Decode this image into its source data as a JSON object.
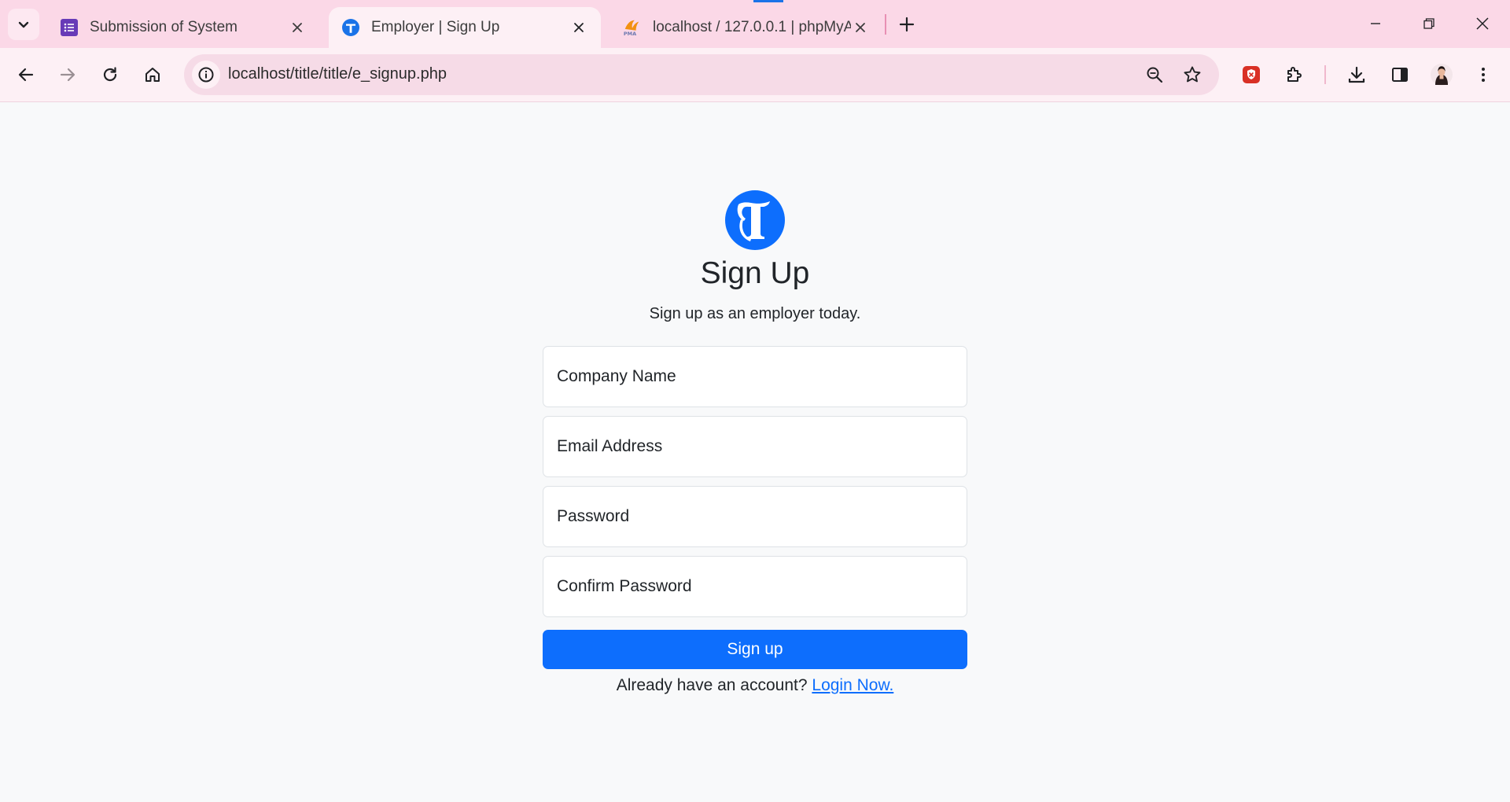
{
  "browser": {
    "tabs": [
      {
        "title": "Submission of System",
        "icon": "forms-icon"
      },
      {
        "title": "Employer | Sign Up",
        "icon": "title-logo-icon",
        "active": true
      },
      {
        "title": "localhost / 127.0.0.1 | phpMyAd",
        "icon": "phpmyadmin-icon"
      }
    ],
    "url": "localhost/title/title/e_signup.php"
  },
  "colors": {
    "tab_strip": "#fbd8e7",
    "primary": "#0d6efd",
    "page_bg": "#f8f9fa"
  },
  "page": {
    "heading": "Sign Up",
    "subheading": "Sign up as an employer today.",
    "fields": {
      "company_name": {
        "placeholder": "Company Name"
      },
      "email": {
        "placeholder": "Email Address"
      },
      "password": {
        "placeholder": "Password"
      },
      "confirm_password": {
        "placeholder": "Confirm Password"
      }
    },
    "submit_label": "Sign up",
    "login_prompt": "Already have an account?",
    "login_link": "Login Now."
  }
}
